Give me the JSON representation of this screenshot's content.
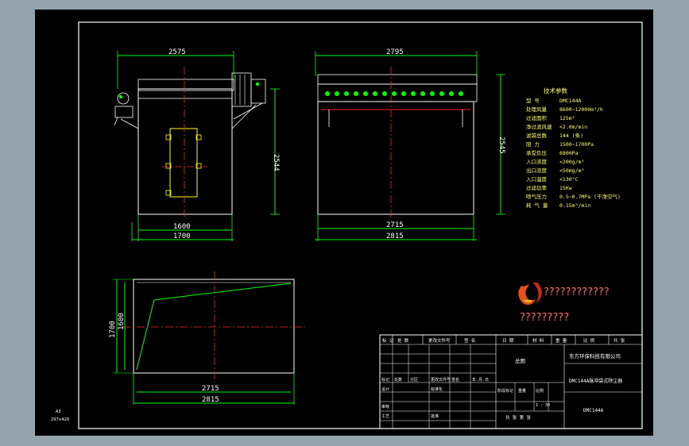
{
  "dimensions": {
    "front_top": "2575",
    "front_height": "2544",
    "front_bottom_inner": "1600",
    "front_bottom_outer": "1700",
    "side_top": "2795",
    "side_height": "2545",
    "side_bottom_inner": "2715",
    "side_bottom_outer": "2815",
    "plan_height_outer": "1700",
    "plan_height_inner": "1600",
    "plan_bottom_inner": "2715",
    "plan_bottom_outer": "2815"
  },
  "specs": {
    "title": "技术参数",
    "rows": [
      {
        "label": "型 号",
        "value": "DMC144A"
      },
      {
        "label": "处理风量",
        "value": "8600~12000m³/h"
      },
      {
        "label": "过滤面积",
        "value": "125m²"
      },
      {
        "label": "净过滤风速",
        "value": "<2.0m/min"
      },
      {
        "label": "滤袋总数",
        "value": "144 (条)"
      },
      {
        "label": "阻 力",
        "value": "1500~1700Pa"
      },
      {
        "label": "承受负压",
        "value": "6800Pa"
      },
      {
        "label": "入口浓度",
        "value": "<200g/m³"
      },
      {
        "label": "出口浓度",
        "value": "<50mg/m³"
      },
      {
        "label": "入口温度",
        "value": "<130°C"
      },
      {
        "label": "过滤功率",
        "value": "15Kw"
      },
      {
        "label": "喷气压力",
        "value": "0.5~0.7MPa (干净空气)"
      },
      {
        "label": "耗 气 量",
        "value": "0.15m³/min"
      }
    ]
  },
  "watermark": {
    "line1": "????????????",
    "line2": "?????????"
  },
  "title_block": {
    "header_cells": [
      "标 记",
      "处 数",
      "更改文件号",
      "签 名",
      "日 期",
      "材 料",
      "重 量",
      "比 例",
      "共 张",
      "第 张"
    ],
    "drawing_name": "总图",
    "company": "东方环保科技有限公司",
    "product": "DMC144A脉冲袋式除尘器",
    "model": "DMC144A",
    "row_labels": [
      "标记",
      "处数",
      "分区",
      "更改文件号",
      "签名",
      "年.月.日"
    ],
    "role_labels": [
      "设计",
      "标准化",
      "审核",
      "工艺",
      "批准"
    ],
    "stage_label": "阶段标记",
    "weight_label": "重量",
    "scale_label": "比例",
    "scale_value": "1 : 30",
    "sheet_label": "共 张 第 张"
  },
  "corner_note": {
    "line1": "A3",
    "line2": "297x420"
  }
}
